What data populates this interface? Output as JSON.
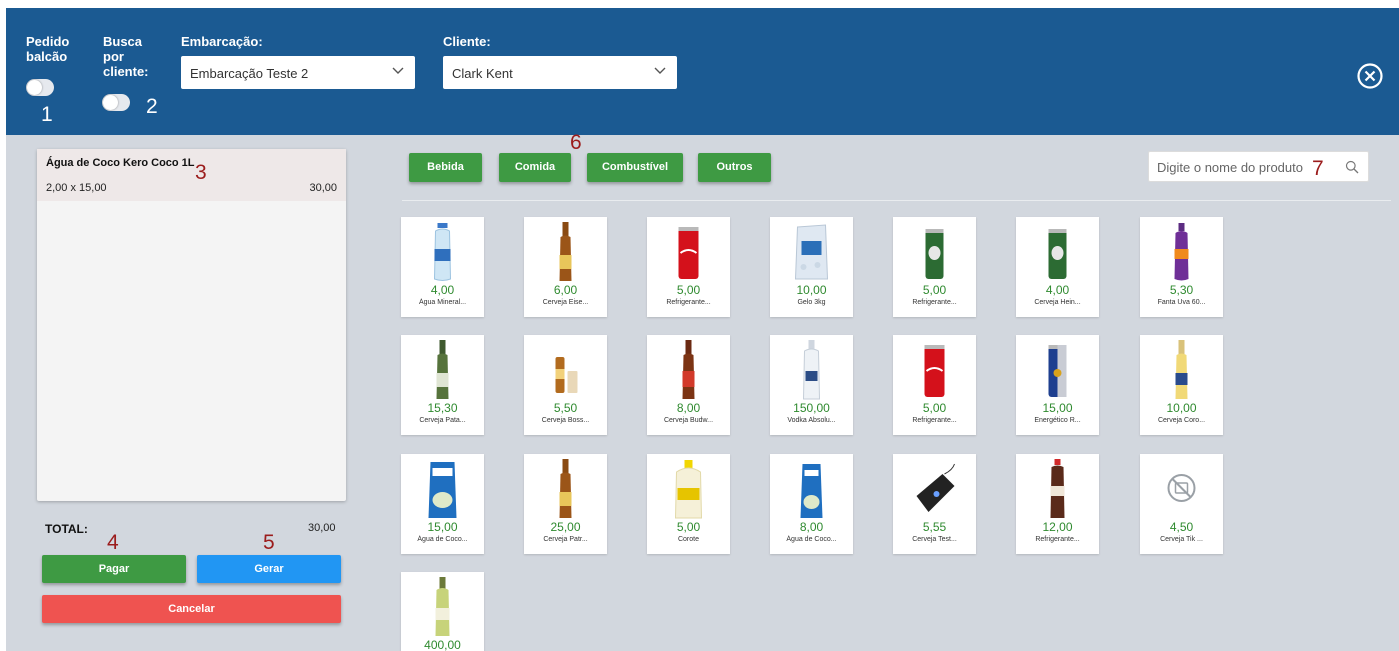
{
  "header": {
    "pedido_balcao_label": "Pedido balcão",
    "busca_cliente_label": "Busca por cliente:",
    "embarcacao_label": "Embarcação:",
    "embarcacao_value": "Embarcação Teste 2",
    "cliente_label": "Cliente:",
    "cliente_value": "Clark Kent"
  },
  "cart": {
    "items": [
      {
        "name": "Água de Coco Kero Coco 1L",
        "qty": "2,00 x 15,00",
        "subtotal": "30,00"
      }
    ],
    "total_label": "TOTAL:",
    "total_value": "30,00"
  },
  "actions": {
    "pay": "Pagar",
    "generate": "Gerar",
    "cancel": "Cancelar"
  },
  "categories": [
    "Bebida",
    "Comida",
    "Combustível",
    "Outros"
  ],
  "search": {
    "placeholder": "Digite o nome do produto"
  },
  "annotations": [
    "1",
    "2",
    "3",
    "4",
    "5",
    "6",
    "7"
  ],
  "products": [
    {
      "price": "4,00",
      "name": "Água Mineral...",
      "icon": "water-bottle"
    },
    {
      "price": "6,00",
      "name": "Cerveja Eise...",
      "icon": "beer-bottle"
    },
    {
      "price": "5,00",
      "name": "Refrigerante...",
      "icon": "coke-can"
    },
    {
      "price": "10,00",
      "name": "Gelo 3kg",
      "icon": "ice-bag"
    },
    {
      "price": "5,00",
      "name": "Refrigerante...",
      "icon": "green-can"
    },
    {
      "price": "4,00",
      "name": "Cerveja Hein...",
      "icon": "green-can"
    },
    {
      "price": "5,30",
      "name": "Fanta Uva 60...",
      "icon": "purple-bottle"
    },
    {
      "price": "15,30",
      "name": "Cerveja Pata...",
      "icon": "beer-bottle-green"
    },
    {
      "price": "5,50",
      "name": "Cerveja Boss...",
      "icon": "beer-small"
    },
    {
      "price": "8,00",
      "name": "Cerveja Budw...",
      "icon": "beer-bottle-red"
    },
    {
      "price": "150,00",
      "name": "Vodka Absolu...",
      "icon": "vodka-bottle"
    },
    {
      "price": "5,00",
      "name": "Refrigerante...",
      "icon": "coke-can"
    },
    {
      "price": "15,00",
      "name": "Energético R...",
      "icon": "energy-can"
    },
    {
      "price": "10,00",
      "name": "Cerveja Coro...",
      "icon": "beer-bottle-clear"
    },
    {
      "price": "15,00",
      "name": "Água de Coco...",
      "icon": "coco-carton"
    },
    {
      "price": "25,00",
      "name": "Cerveja Patr...",
      "icon": "beer-bottle"
    },
    {
      "price": "5,00",
      "name": "Corote",
      "icon": "corote-bottle"
    },
    {
      "price": "8,00",
      "name": "Água de Coco...",
      "icon": "coco-carton-small"
    },
    {
      "price": "5,55",
      "name": "Cerveja Test...",
      "icon": "card-reader"
    },
    {
      "price": "12,00",
      "name": "Refrigerante...",
      "icon": "soda-bottle"
    },
    {
      "price": "4,50",
      "name": "Cerveja Tik ...",
      "icon": "no-image"
    },
    {
      "price": "400,00",
      "name": "",
      "icon": "wine-bottle"
    }
  ]
}
